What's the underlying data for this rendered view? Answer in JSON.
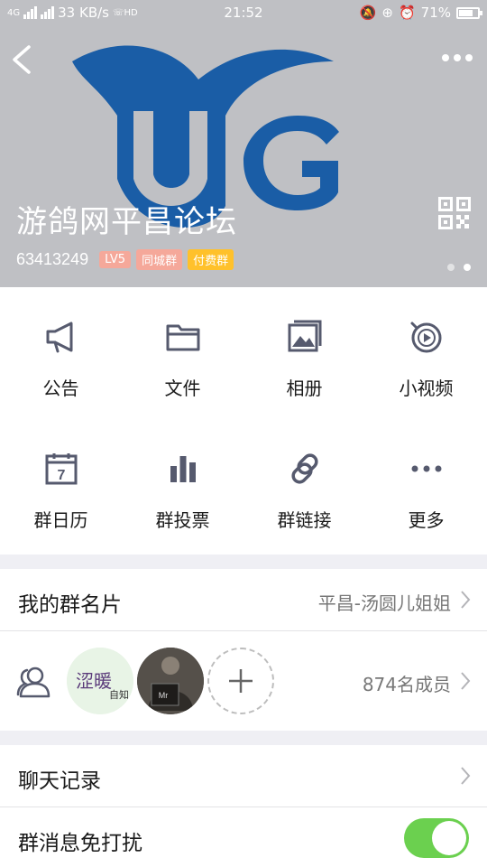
{
  "status_bar": {
    "network": "4G",
    "speed": "33 KB/s",
    "hd": "HD",
    "time": "21:52",
    "battery": "71%"
  },
  "header": {
    "title": "游鸽网平昌论坛",
    "group_id": "63413249",
    "tags": {
      "level": "LV5",
      "city": "同城群",
      "paid": "付费群"
    },
    "logo_text": "UG",
    "colors": {
      "logo": "#1a5da6",
      "bg": "#bfc0c4"
    }
  },
  "features": [
    {
      "label": "公告",
      "icon": "megaphone-icon"
    },
    {
      "label": "文件",
      "icon": "folder-icon"
    },
    {
      "label": "相册",
      "icon": "album-icon"
    },
    {
      "label": "小视频",
      "icon": "video-icon"
    },
    {
      "label": "群日历",
      "icon": "calendar-icon",
      "date": "7"
    },
    {
      "label": "群投票",
      "icon": "vote-icon"
    },
    {
      "label": "群链接",
      "icon": "link-icon"
    },
    {
      "label": "更多",
      "icon": "more-dots-icon"
    }
  ],
  "card": {
    "label": "我的群名片",
    "value": "平昌-汤圆儿姐姐"
  },
  "members": {
    "count_label": "874名成员",
    "avatar1_text": "涩暖",
    "avatar1_sub": "自知",
    "avatar2_text": "Mr"
  },
  "chat_history": {
    "label": "聊天记录"
  },
  "mute": {
    "label": "群消息免打扰",
    "enabled": true,
    "color": "#6bd04f"
  },
  "icon_color": "#565a6e"
}
